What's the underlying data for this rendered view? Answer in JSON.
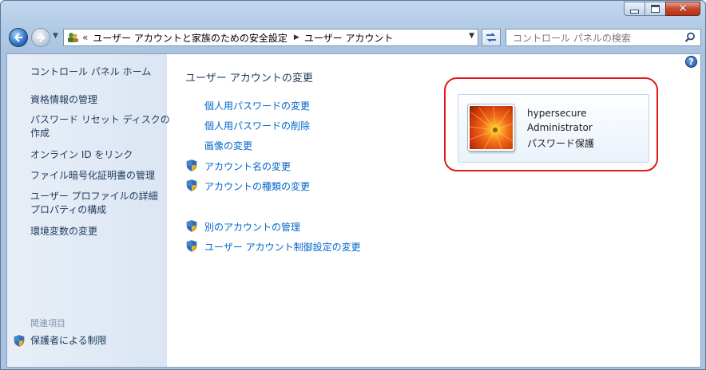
{
  "window": {
    "close_glyph": "✕"
  },
  "address": {
    "chevron": "«",
    "crumbs": [
      "ユーザー アカウントと家族のための安全設定",
      "ユーザー アカウント"
    ]
  },
  "search": {
    "placeholder": "コントロール パネルの検索"
  },
  "sidebar": {
    "home": "コントロール パネル ホーム",
    "items": [
      "資格情報の管理",
      "パスワード リセット ディスクの作成",
      "オンライン ID をリンク",
      "ファイル暗号化証明書の管理",
      "ユーザー プロファイルの詳細プロパティの構成",
      "環境変数の変更"
    ],
    "related_title": "関連項目",
    "related_items": [
      "保護者による制限"
    ]
  },
  "main": {
    "heading": "ユーザー アカウントの変更",
    "tasks": [
      {
        "label": "個人用パスワードの変更",
        "shield": false
      },
      {
        "label": "個人用パスワードの削除",
        "shield": false
      },
      {
        "label": "画像の変更",
        "shield": false
      },
      {
        "label": "アカウント名の変更",
        "shield": true
      },
      {
        "label": "アカウントの種類の変更",
        "shield": true
      }
    ],
    "other_tasks": [
      {
        "label": "別のアカウントの管理",
        "shield": true
      },
      {
        "label": "ユーザー アカウント制御設定の変更",
        "shield": true
      }
    ],
    "help": "?"
  },
  "user": {
    "name": "hypersecure",
    "role": "Administrator",
    "status": "パスワード保護"
  },
  "icons": {
    "back": "back-arrow-icon",
    "forward": "forward-arrow-icon",
    "refresh": "refresh-icon",
    "search": "magnifier-icon",
    "shield": "uac-shield-icon",
    "help": "help-icon"
  },
  "colors": {
    "link": "#0066cc",
    "sidebar_text": "#1e395b",
    "highlight": "#e01a1a"
  }
}
